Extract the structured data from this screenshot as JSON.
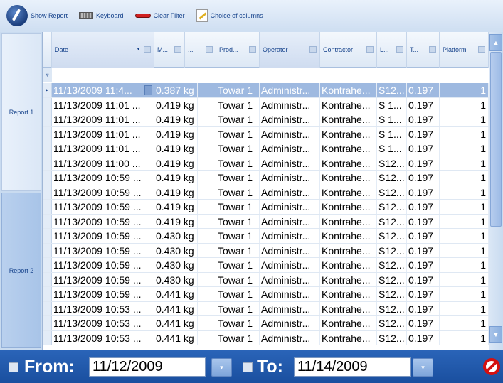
{
  "toolbar": {
    "show_report": "Show Report",
    "keyboard": "Keyboard",
    "clear_filter": "Clear Filter",
    "choice_of_columns": "Choice of columns"
  },
  "sidebar": {
    "report1": "Report 1",
    "report2": "Report 2"
  },
  "columns": [
    "Date",
    "M...",
    "...",
    "Prod...",
    "Operator",
    "Contractor",
    "L...",
    "T...",
    "Platform"
  ],
  "rows": [
    {
      "date": "11/13/2009 11:4...",
      "m": "0.387 kg",
      "prod": "Towar 1",
      "operator": "Administr...",
      "contractor": "Kontrahe...",
      "l": "S12...",
      "t": "0.197",
      "platform": "1"
    },
    {
      "date": "11/13/2009 11:01 ...",
      "m": "0.419 kg",
      "prod": "Towar 1",
      "operator": "Administr...",
      "contractor": "Kontrahe...",
      "l": "S 1...",
      "t": "0.197",
      "platform": "1"
    },
    {
      "date": "11/13/2009 11:01 ...",
      "m": "0.419 kg",
      "prod": "Towar 1",
      "operator": "Administr...",
      "contractor": "Kontrahe...",
      "l": "S 1...",
      "t": "0.197",
      "platform": "1"
    },
    {
      "date": "11/13/2009 11:01 ...",
      "m": "0.419 kg",
      "prod": "Towar 1",
      "operator": "Administr...",
      "contractor": "Kontrahe...",
      "l": "S 1...",
      "t": "0.197",
      "platform": "1"
    },
    {
      "date": "11/13/2009 11:01 ...",
      "m": "0.419 kg",
      "prod": "Towar 1",
      "operator": "Administr...",
      "contractor": "Kontrahe...",
      "l": "S 1...",
      "t": "0.197",
      "platform": "1"
    },
    {
      "date": "11/13/2009 11:00 ...",
      "m": "0.419 kg",
      "prod": "Towar 1",
      "operator": "Administr...",
      "contractor": "Kontrahe...",
      "l": "S12...",
      "t": "0.197",
      "platform": "1"
    },
    {
      "date": "11/13/2009 10:59 ...",
      "m": "0.419 kg",
      "prod": "Towar 1",
      "operator": "Administr...",
      "contractor": "Kontrahe...",
      "l": "S12...",
      "t": "0.197",
      "platform": "1"
    },
    {
      "date": "11/13/2009 10:59 ...",
      "m": "0.419 kg",
      "prod": "Towar 1",
      "operator": "Administr...",
      "contractor": "Kontrahe...",
      "l": "S12...",
      "t": "0.197",
      "platform": "1"
    },
    {
      "date": "11/13/2009 10:59 ...",
      "m": "0.419 kg",
      "prod": "Towar 1",
      "operator": "Administr...",
      "contractor": "Kontrahe...",
      "l": "S12...",
      "t": "0.197",
      "platform": "1"
    },
    {
      "date": "11/13/2009 10:59 ...",
      "m": "0.419 kg",
      "prod": "Towar 1",
      "operator": "Administr...",
      "contractor": "Kontrahe...",
      "l": "S12...",
      "t": "0.197",
      "platform": "1"
    },
    {
      "date": "11/13/2009 10:59 ...",
      "m": "0.430 kg",
      "prod": "Towar 1",
      "operator": "Administr...",
      "contractor": "Kontrahe...",
      "l": "S12...",
      "t": "0.197",
      "platform": "1"
    },
    {
      "date": "11/13/2009 10:59 ...",
      "m": "0.430 kg",
      "prod": "Towar 1",
      "operator": "Administr...",
      "contractor": "Kontrahe...",
      "l": "S12...",
      "t": "0.197",
      "platform": "1"
    },
    {
      "date": "11/13/2009 10:59 ...",
      "m": "0.430 kg",
      "prod": "Towar 1",
      "operator": "Administr...",
      "contractor": "Kontrahe...",
      "l": "S12...",
      "t": "0.197",
      "platform": "1"
    },
    {
      "date": "11/13/2009 10:59 ...",
      "m": "0.430 kg",
      "prod": "Towar 1",
      "operator": "Administr...",
      "contractor": "Kontrahe...",
      "l": "S12...",
      "t": "0.197",
      "platform": "1"
    },
    {
      "date": "11/13/2009 10:59 ...",
      "m": "0.441 kg",
      "prod": "Towar 1",
      "operator": "Administr...",
      "contractor": "Kontrahe...",
      "l": "S12...",
      "t": "0.197",
      "platform": "1"
    },
    {
      "date": "11/13/2009 10:53 ...",
      "m": "0.441 kg",
      "prod": "Towar 1",
      "operator": "Administr...",
      "contractor": "Kontrahe...",
      "l": "S12...",
      "t": "0.197",
      "platform": "1"
    },
    {
      "date": "11/13/2009 10:53 ...",
      "m": "0.441 kg",
      "prod": "Towar 1",
      "operator": "Administr...",
      "contractor": "Kontrahe...",
      "l": "S12...",
      "t": "0.197",
      "platform": "1"
    },
    {
      "date": "11/13/2009 10:53 ...",
      "m": "0.441 kg",
      "prod": "Towar 1",
      "operator": "Administr...",
      "contractor": "Kontrahe...",
      "l": "S12...",
      "t": "0.197",
      "platform": "1"
    }
  ],
  "footer": {
    "from_label": "From:",
    "from_value": "11/12/2009",
    "to_label": "To:",
    "to_value": "11/14/2009"
  }
}
